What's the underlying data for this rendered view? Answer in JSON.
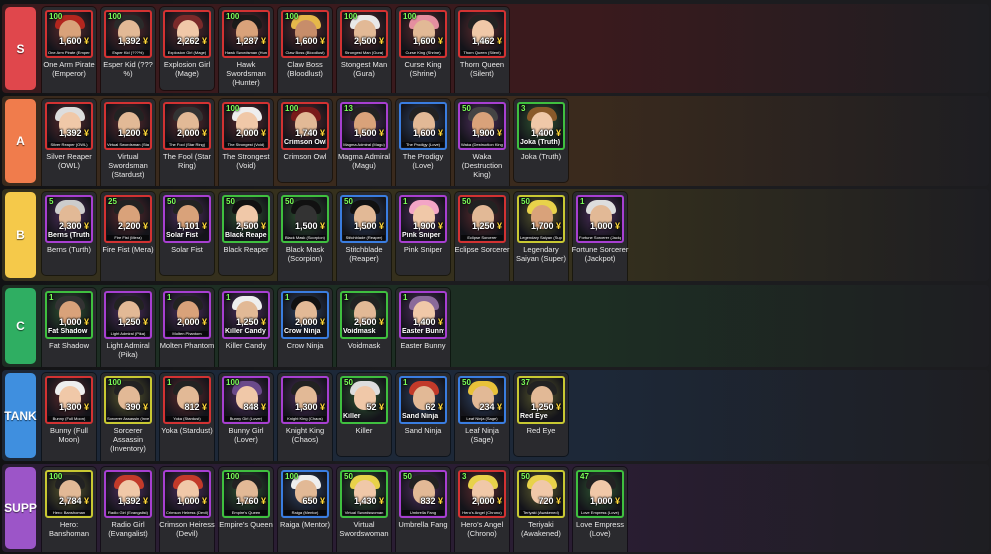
{
  "tiers": [
    {
      "label": "S",
      "color": "#e0474c",
      "bg": "#3a1a1d",
      "units": [
        {
          "level": "100",
          "cost": "1,600",
          "name": "One Arm Pirate (Emperor)",
          "mini": "One Arm Pirate (Emperor)",
          "frame": "#d23232",
          "skin": "#d9a27a",
          "hair": "#b3261e",
          "tall": true
        },
        {
          "level": "100",
          "cost": "1,392",
          "name": "Esper Kid (??? %)",
          "mini": "Esper Kid (???%)",
          "frame": "#d23232",
          "skin": "#e2b996",
          "hair": "#2a2a2a",
          "tall": true
        },
        {
          "level": "",
          "cost": "2,262",
          "name": "Explosion Girl (Mage)",
          "mini": "Explosion Girl (Mage)",
          "frame": "#d23232",
          "skin": "#f0c8a8",
          "hair": "#7a2a2a",
          "tall": false
        },
        {
          "level": "100",
          "cost": "1,287",
          "name": "Hawk Swordsman (Hunter)",
          "mini": "Hawk Swordsman (Hunter)",
          "frame": "#d23232",
          "skin": "#d9a27a",
          "hair": "#1a1a1a",
          "tall": true
        },
        {
          "level": "100",
          "cost": "1,600",
          "name": "Claw Boss (Bloodlust)",
          "mini": "Claw Boss (Bloodlust)",
          "frame": "#d23232",
          "skin": "#c78d6a",
          "hair": "#e5b84a",
          "tall": true
        },
        {
          "level": "100",
          "cost": "2,500",
          "name": "Stongest Man (Gura)",
          "mini": "Strongest Man (Gura)",
          "frame": "#d23232",
          "skin": "#e2b996",
          "hair": "#e8e8e8",
          "tall": true
        },
        {
          "level": "100",
          "cost": "1,600",
          "name": "Curse King (Shrine)",
          "mini": "Curse King (Shrine)",
          "frame": "#d23232",
          "skin": "#e2b996",
          "hair": "#e58fa0",
          "tall": true
        },
        {
          "level": "",
          "cost": "1,462",
          "name": "Thorn Queen (Silent)",
          "mini": "Thorn Queen (Silent)",
          "frame": "#d23232",
          "skin": "#f0c8a8",
          "hair": "#222",
          "tall": true
        }
      ]
    },
    {
      "label": "A",
      "color": "#f07c4c",
      "bg": "#3a2a1d",
      "units": [
        {
          "level": "",
          "cost": "1,392",
          "name": "Silver Reaper (OWL)",
          "mini": "Silver Reaper (OWL)",
          "frame": "#d23232",
          "skin": "#f0c8a8",
          "hair": "#ddd",
          "tall": true
        },
        {
          "level": "",
          "cost": "1,200",
          "name": "Virtual Swordsman (Stardust)",
          "mini": "Virtual Swordsman (Stardust)",
          "frame": "#d23232",
          "skin": "#e2b996",
          "hair": "#222",
          "tall": true
        },
        {
          "level": "",
          "cost": "2,000",
          "name": "The Fool (Star Ring)",
          "mini": "The Fool (Star Ring)",
          "frame": "#d23232",
          "skin": "#e2b996",
          "hair": "#333",
          "tall": true
        },
        {
          "level": "100",
          "cost": "2,000",
          "name": "The Strongest (Void)",
          "mini": "The Strongest (Void)",
          "frame": "#d23232",
          "skin": "#f0c8a8",
          "hair": "#eee",
          "tall": true
        },
        {
          "level": "100",
          "cost": "1,740",
          "name": "Crimson Owl",
          "mini": "Crimson Owl",
          "frame": "#d23232",
          "skin": "#e2b996",
          "hair": "#7a1a1a",
          "tall": false,
          "big": true
        },
        {
          "level": "13",
          "cost": "1,500",
          "name": "Magma Admiral (Magu)",
          "mini": "Magma Admiral (Magu)",
          "frame": "#a73fd1",
          "skin": "#d9a27a",
          "hair": "#222",
          "tall": true
        },
        {
          "level": "",
          "cost": "1,600",
          "name": "The Prodigy (Love)",
          "mini": "The Prodigy (Love)",
          "frame": "#3a7de0",
          "skin": "#e2b996",
          "hair": "#222",
          "tall": true
        },
        {
          "level": "50",
          "cost": "1,900",
          "name": "Waka (Destruction King)",
          "mini": "Waka (Destruction King)",
          "frame": "#a73fd1",
          "skin": "#d9a27a",
          "hair": "#444",
          "tall": true
        },
        {
          "level": "3",
          "cost": "1,400",
          "name": "Joka (Truth)",
          "mini": "Joka (Truth)",
          "frame": "#3fbf3f",
          "skin": "#f0c8a8",
          "hair": "#8a5a2a",
          "tall": false,
          "big": true
        }
      ]
    },
    {
      "label": "B",
      "color": "#f5c94a",
      "bg": "#35301d",
      "units": [
        {
          "level": "5",
          "cost": "2,300",
          "name": "Berns (Turth)",
          "mini": "Berns (Truth)",
          "frame": "#a73fd1",
          "skin": "#e2b996",
          "hair": "#ccc",
          "tall": false,
          "big": true
        },
        {
          "level": "25",
          "cost": "2,200",
          "name": "Fire Fist (Mera)",
          "mini": "Fire Fist (Mera)",
          "frame": "#d23232",
          "skin": "#d9a27a",
          "hair": "#222",
          "tall": true
        },
        {
          "level": "50",
          "cost": "1,101",
          "name": "Solar Fist",
          "mini": "Solar Fist",
          "frame": "#a73fd1",
          "skin": "#d9a27a",
          "hair": "#222",
          "tall": false,
          "big": true
        },
        {
          "level": "50",
          "cost": "2,500",
          "name": "Black Reaper",
          "mini": "Black Reaper",
          "frame": "#3fbf3f",
          "skin": "#f0c8a8",
          "hair": "#111",
          "tall": false,
          "big": true
        },
        {
          "level": "50",
          "cost": "1,500",
          "name": "Black Mask (Scorpion)",
          "mini": "Black Mask (Scorpion)",
          "frame": "#3fbf3f",
          "skin": "#333",
          "hair": "#111",
          "tall": true
        },
        {
          "level": "50",
          "cost": "1,500",
          "name": "Stitchblade (Reaper)",
          "mini": "Stitchblade (Reaper)",
          "frame": "#3a7de0",
          "skin": "#e2b996",
          "hair": "#111",
          "tall": true
        },
        {
          "level": "1",
          "cost": "1,900",
          "name": "Pink Sniper",
          "mini": "Pink Sniper",
          "frame": "#a73fd1",
          "skin": "#f0c8a8",
          "hair": "#f3a5c6",
          "tall": false,
          "big": true
        },
        {
          "level": "50",
          "cost": "1,250",
          "name": "Eclipse Sorcerer",
          "mini": "Eclipse Sorcerer",
          "frame": "#d23232",
          "skin": "#e2b996",
          "hair": "#222",
          "tall": true
        },
        {
          "level": "50",
          "cost": "1,700",
          "name": "Legendary Saiyan (Super)",
          "mini": "Legendary Saiyan (Super)",
          "frame": "#c8c832",
          "skin": "#d9a27a",
          "hair": "#e8d24a",
          "tall": true
        },
        {
          "level": "1",
          "cost": "1,000",
          "name": "Fortune Sorcerer (Jackpot)",
          "mini": "Fortune Sorcerer (Jackpot)",
          "frame": "#a73fd1",
          "skin": "#e2b996",
          "hair": "#ddd",
          "tall": true
        }
      ]
    },
    {
      "label": "C",
      "color": "#2fae62",
      "bg": "#1d2e23",
      "units": [
        {
          "level": "1",
          "cost": "1,000",
          "name": "Fat Shadow",
          "mini": "Fat Shadow",
          "frame": "#3fbf3f",
          "skin": "#d9a27a",
          "hair": "#333",
          "tall": false,
          "big": true
        },
        {
          "level": "",
          "cost": "1,250",
          "name": "Light Admiral (Pika)",
          "mini": "Light Admiral (Pika)",
          "frame": "#a73fd1",
          "skin": "#e2b996",
          "hair": "#222",
          "tall": true
        },
        {
          "level": "1",
          "cost": "2,000",
          "name": "Molten Phantom",
          "mini": "Molten Phantom",
          "frame": "#a73fd1",
          "skin": "#d9a27a",
          "hair": "#222",
          "tall": true
        },
        {
          "level": "1",
          "cost": "1,250",
          "name": "Killer Candy",
          "mini": "Killer Candy",
          "frame": "#a73fd1",
          "skin": "#e2b996",
          "hair": "#eee",
          "tall": false,
          "big": true
        },
        {
          "level": "1",
          "cost": "2,000",
          "name": "Crow Ninja",
          "mini": "Crow Ninja",
          "frame": "#3a7de0",
          "skin": "#e2b996",
          "hair": "#111",
          "tall": false,
          "big": true
        },
        {
          "level": "1",
          "cost": "2,500",
          "name": "Voidmask",
          "mini": "Voidmask",
          "frame": "#3fbf3f",
          "skin": "#e2b996",
          "hair": "#222",
          "tall": false,
          "big": true
        },
        {
          "level": "1",
          "cost": "1,400",
          "name": "Easter Bunny",
          "mini": "Easter Bunny",
          "frame": "#a73fd1",
          "skin": "#f0c8a8",
          "hair": "#8a6a9a",
          "tall": false,
          "big": true
        }
      ]
    },
    {
      "label": "TANK",
      "color": "#3f8fdf",
      "bg": "#1d2838",
      "units": [
        {
          "level": "",
          "cost": "1,300",
          "name": "Bunny (Full Moon)",
          "mini": "Bunny (Full Moon)",
          "frame": "#d23232",
          "skin": "#f0c8a8",
          "hair": "#eee",
          "tall": true
        },
        {
          "level": "100",
          "cost": "390",
          "name": "Sorcerer Assassin (Inventory)",
          "mini": "Sorcerer Assassin (Inventory)",
          "frame": "#c8c832",
          "skin": "#e2b996",
          "hair": "#222",
          "tall": true
        },
        {
          "level": "1",
          "cost": "812",
          "name": "Yoka (Stardust)",
          "mini": "Yoka (Stardust)",
          "frame": "#d23232",
          "skin": "#e2b996",
          "hair": "#222",
          "tall": true
        },
        {
          "level": "100",
          "cost": "848",
          "name": "Bunny Girl (Lover)",
          "mini": "Bunny Girl (Lover)",
          "frame": "#a73fd1",
          "skin": "#f0c8a8",
          "hair": "#6a4a8a",
          "tall": true
        },
        {
          "level": "",
          "cost": "1,300",
          "name": "Knight King (Chaos)",
          "mini": "Knight King (Chaos)",
          "frame": "#a73fd1",
          "skin": "#e2b996",
          "hair": "#222",
          "tall": true
        },
        {
          "level": "50",
          "cost": "52",
          "name": "Killer",
          "mini": "Killer",
          "frame": "#3fbf3f",
          "skin": "#f0c8a8",
          "hair": "#ddd",
          "tall": false,
          "big": true
        },
        {
          "level": "1",
          "cost": "62",
          "name": "Sand Ninja",
          "mini": "Sand Ninja",
          "frame": "#3a7de0",
          "skin": "#e2b996",
          "hair": "#c23a2a",
          "tall": false,
          "big": true
        },
        {
          "level": "50",
          "cost": "234",
          "name": "Leaf Ninja (Sage)",
          "mini": "Leaf Ninja (Sage)",
          "frame": "#3a7de0",
          "skin": "#e2b996",
          "hair": "#e8c23a",
          "tall": true
        },
        {
          "level": "37",
          "cost": "1,250",
          "name": "Red Eye",
          "mini": "Red Eye",
          "frame": "#c8c832",
          "skin": "#e2b996",
          "hair": "#222",
          "tall": false,
          "big": true
        }
      ]
    },
    {
      "label": "SUPP",
      "color": "#9c55c8",
      "bg": "#2a1d33",
      "units": [
        {
          "level": "100",
          "cost": "2,784",
          "name": "Hero: Banshoman",
          "mini": "Hero: Banshoman",
          "frame": "#c8c832",
          "skin": "#e2b996",
          "hair": "#222",
          "tall": true
        },
        {
          "level": "",
          "cost": "1,392",
          "name": "Radio Girl (Evangalist)",
          "mini": "Radio Girl (Evangalist)",
          "frame": "#a73fd1",
          "skin": "#f0c8a8",
          "hair": "#c23a2a",
          "tall": true
        },
        {
          "level": "",
          "cost": "1,000",
          "name": "Crimson Heiress (Devil)",
          "mini": "Crimson Heiress (Devil)",
          "frame": "#a73fd1",
          "skin": "#f0c8a8",
          "hair": "#c23a2a",
          "tall": true
        },
        {
          "level": "100",
          "cost": "1,760",
          "name": "Empire's Queen",
          "mini": "Empire's Queen",
          "frame": "#3fbf3f",
          "skin": "#e2b996",
          "hair": "#222",
          "tall": true
        },
        {
          "level": "100",
          "cost": "650",
          "name": "Raiga (Mentor)",
          "mini": "Raiga (Mentor)",
          "frame": "#3a7de0",
          "skin": "#e2b996",
          "hair": "#eee",
          "tall": true
        },
        {
          "level": "50",
          "cost": "1,430",
          "name": "Virtual Swordswoman",
          "mini": "Virtual Swordswoman",
          "frame": "#3fbf3f",
          "skin": "#f0c8a8",
          "hair": "#e8d24a",
          "tall": true
        },
        {
          "level": "50",
          "cost": "832",
          "name": "Umbrella Fang",
          "mini": "Umbrella Fang",
          "frame": "#a73fd1",
          "skin": "#e2b996",
          "hair": "#222",
          "tall": true
        },
        {
          "level": "3",
          "cost": "2,000",
          "name": "Hero's Angel (Chrono)",
          "mini": "Hero's Angel (Chrono)",
          "frame": "#d23232",
          "skin": "#f0c8a8",
          "hair": "#e8d24a",
          "tall": true
        },
        {
          "level": "50",
          "cost": "720",
          "name": "Teriyaki (Awakened)",
          "mini": "Teriyaki (Awakened)",
          "frame": "#c8c832",
          "skin": "#f0c8a8",
          "hair": "#e8d24a",
          "tall": true
        },
        {
          "level": "47",
          "cost": "1,000",
          "name": "Love Empress (Love)",
          "mini": "Love Empress (Love)",
          "frame": "#3fbf3f",
          "skin": "#f0c8a8",
          "hair": "#222",
          "tall": true
        }
      ]
    }
  ],
  "currency_symbol": "¥"
}
